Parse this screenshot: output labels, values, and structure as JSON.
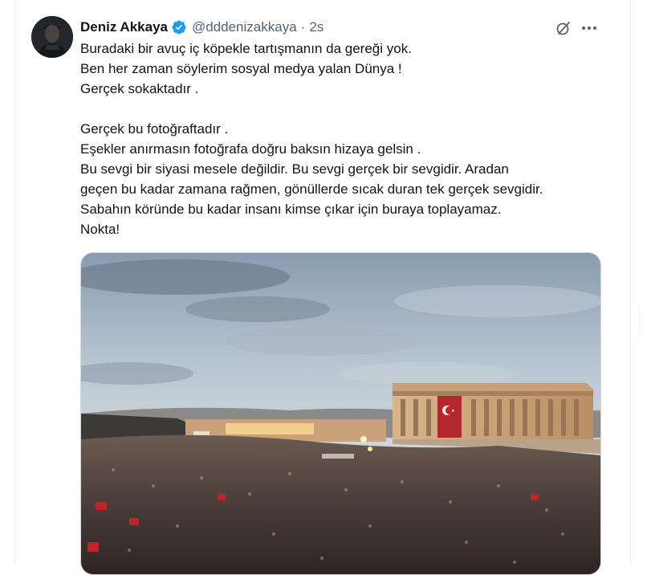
{
  "author": {
    "display_name": "Deniz Akkaya",
    "handle": "@dddenizakkaya",
    "separator": "·",
    "time": "2s",
    "verified_color": "#1d9bf0"
  },
  "actions": {
    "grok_icon": "grok-icon",
    "more_icon": "more-horizontal-icon"
  },
  "tweet": {
    "lines": [
      "Buradaki bir avuç iç köpekle tartışmanın da gereği yok.",
      "Ben her zaman söylerim sosyal medya yalan Dünya !",
      "Gerçek sokaktadır .",
      "",
      "Gerçek bu fotoğraftadır .",
      "Eşekler anırmasın fotoğrafa doğru baksın hizaya gelsin .",
      "Bu sevgi bir siyasi mesele değildir. Bu sevgi gerçek bir sevgidir. Aradan",
      "geçen bu kadar zamana rağmen, gönüllerde sıcak duran tek gerçek sevgidir.",
      "Sabahın köründe bu kadar insanı kimse çıkar için buraya toplayamaz.",
      "Nokta!"
    ]
  },
  "media": {
    "description_icon": "photo-crowd-mausoleum"
  }
}
